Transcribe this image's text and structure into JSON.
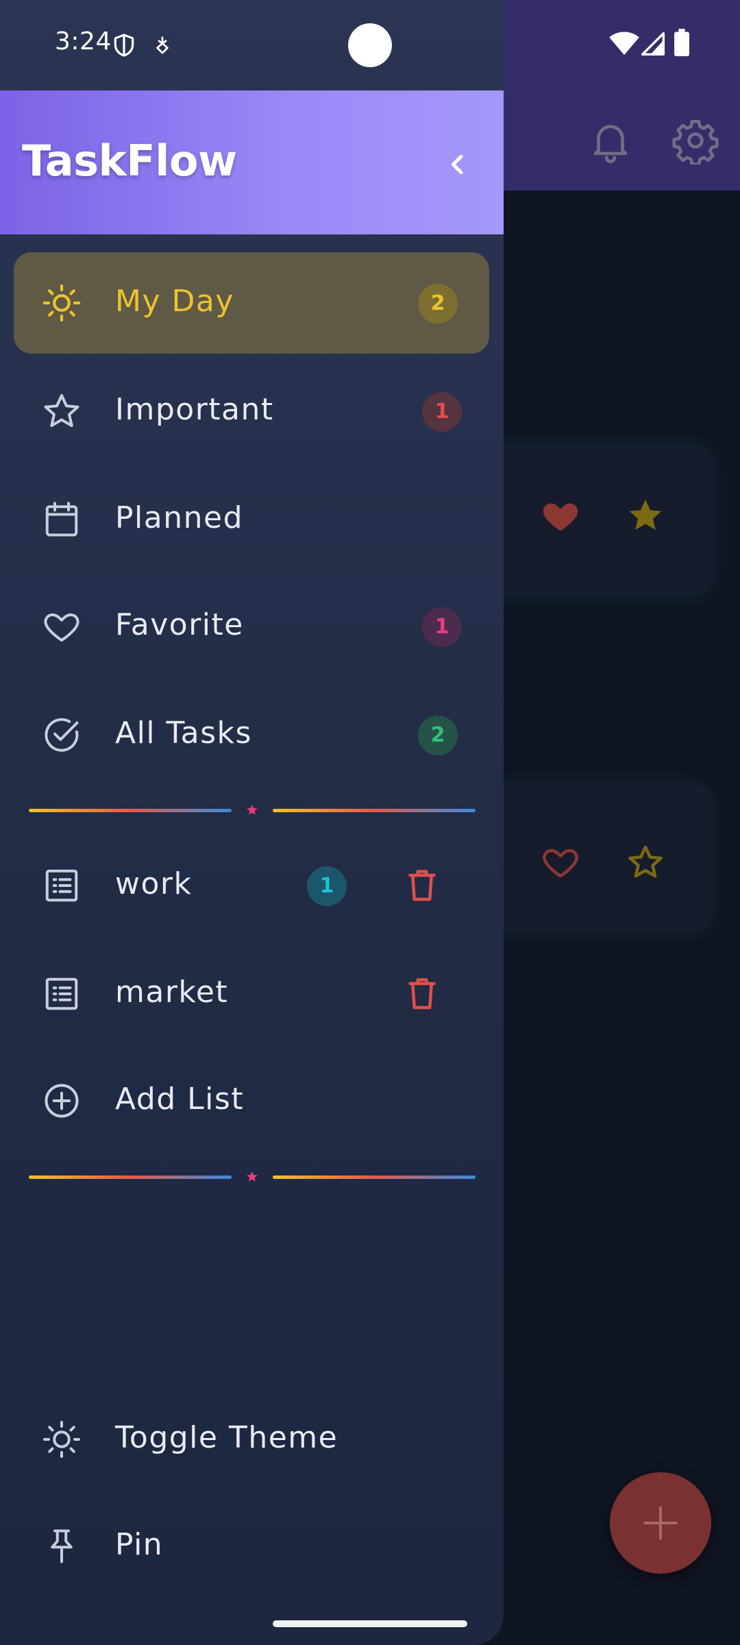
{
  "status_bar": {
    "time": "3:24"
  },
  "drawer": {
    "title": "TaskFlow",
    "nav_items": [
      {
        "label": "My Day",
        "icon": "sun-icon",
        "badge": "2",
        "badge_color": "#f0c32a",
        "active": true
      },
      {
        "label": "Important",
        "icon": "star-outline-icon",
        "badge": "1",
        "badge_color": "#e0504a"
      },
      {
        "label": "Planned",
        "icon": "calendar-icon"
      },
      {
        "label": "Favorite",
        "icon": "heart-outline-icon",
        "badge": "1",
        "badge_color": "#e63e7a"
      },
      {
        "label": "All Tasks",
        "icon": "check-circle-icon",
        "badge": "2",
        "badge_color": "#2ec27e"
      }
    ],
    "lists": [
      {
        "label": "work",
        "icon": "list-icon",
        "badge": "1",
        "badge_color": "#1cc3d6",
        "delete_icon": "trash-icon"
      },
      {
        "label": "market",
        "icon": "list-icon",
        "delete_icon": "trash-icon"
      }
    ],
    "add_list": {
      "label": "Add List",
      "icon": "plus-circle-icon"
    },
    "footer": [
      {
        "label": "Toggle Theme",
        "icon": "sun-icon"
      },
      {
        "label": "Pin",
        "icon": "pin-icon"
      }
    ]
  },
  "background_app": {
    "topbar_icons": [
      "bell-icon",
      "gear-icon"
    ],
    "cards": [
      {
        "favorite": true,
        "important": true
      },
      {
        "favorite": false,
        "important": false
      }
    ],
    "fab_icon": "plus-icon"
  },
  "colors": {
    "accent": "#f0c32a",
    "header_gradient_start": "#7c63e6",
    "header_gradient_end": "#a498fa",
    "drawer_bg": "#263050",
    "danger": "#e0504a"
  }
}
